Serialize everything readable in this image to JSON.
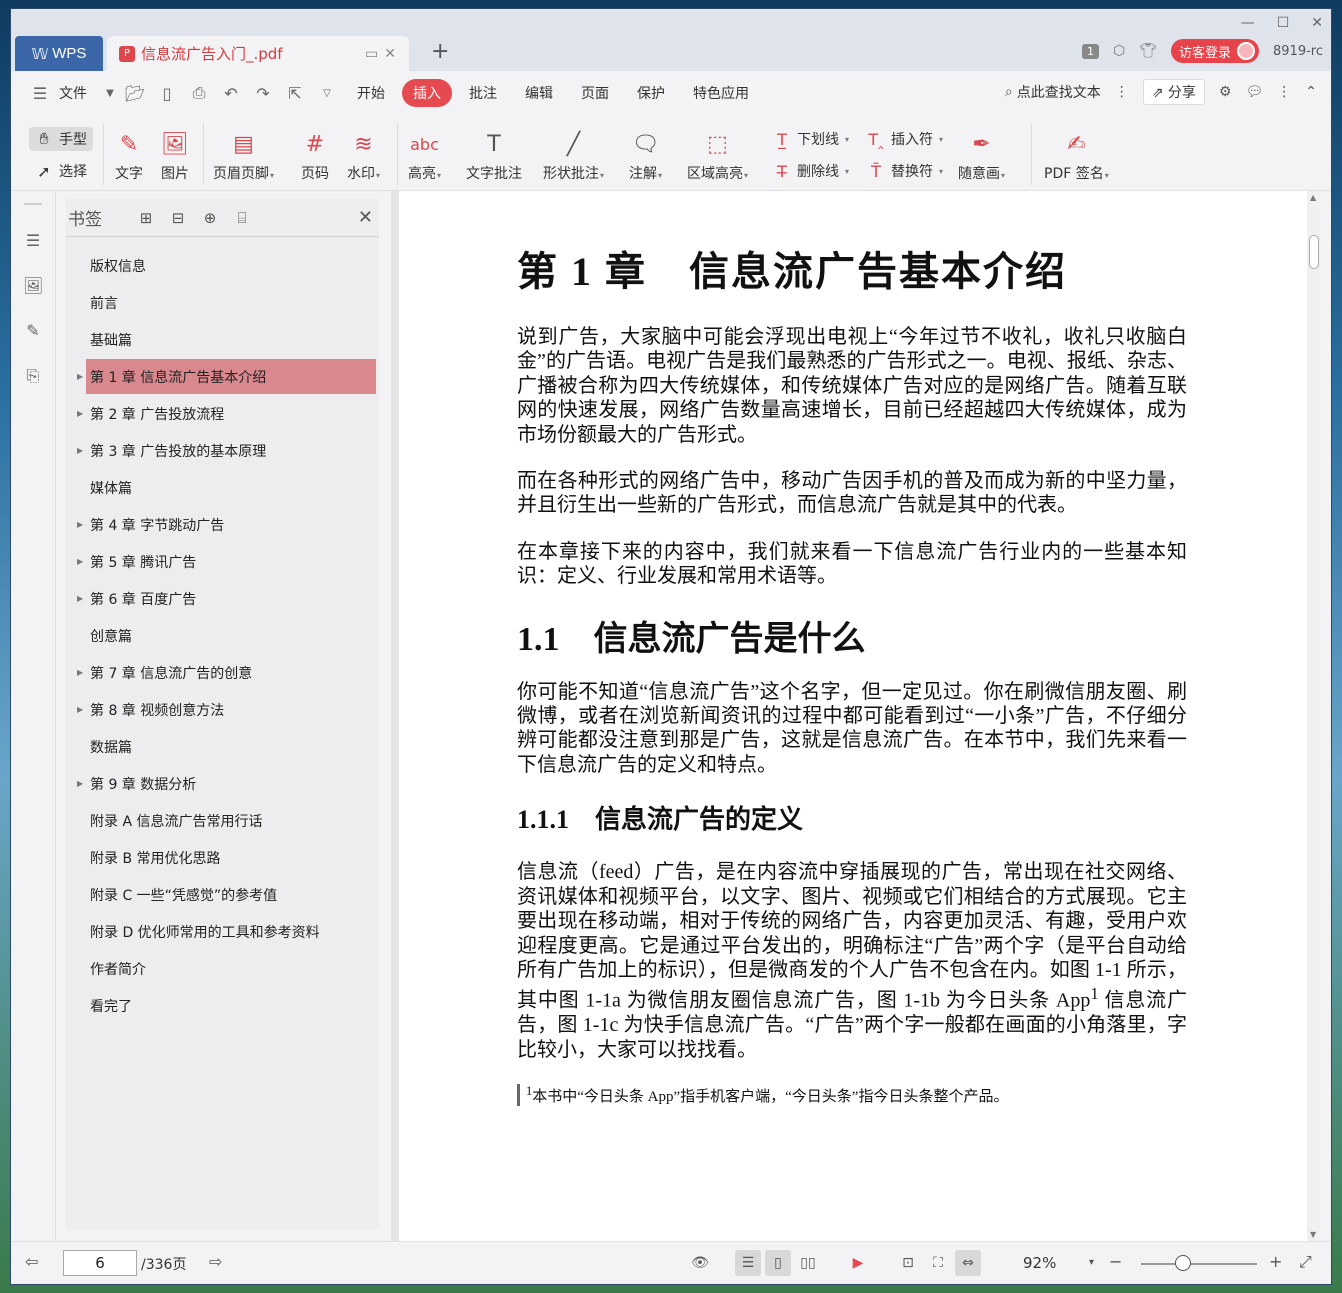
{
  "titlebar": {
    "app_tab": "WPS",
    "doc_tab": "信息流广告入门_.pdf",
    "page_badge": "1",
    "login": "访客登录",
    "user_id": "8919-rc"
  },
  "menubar": {
    "file": "文件",
    "items": [
      "开始",
      "插入",
      "批注",
      "编辑",
      "页面",
      "保护",
      "特色应用"
    ],
    "active": "插入",
    "search": "点此查找文本",
    "share": "分享"
  },
  "toolbar": {
    "hand": "手型",
    "select": "选择",
    "text": "文字",
    "image": "图片",
    "header_footer": "页眉页脚",
    "page_num": "页码",
    "watermark": "水印",
    "highlight": "高亮",
    "text_note": "文字批注",
    "shape_note": "形状批注",
    "annotation": "注解",
    "area_highlight": "区域高亮",
    "underline": "下划线",
    "strikethrough": "删除线",
    "insert_mark": "插入符",
    "replace_mark": "替换符",
    "freehand": "随意画",
    "pdf_sign": "PDF 签名"
  },
  "bookmarks": {
    "title": "书签",
    "items": [
      {
        "label": "版权信息",
        "expandable": false
      },
      {
        "label": "前言",
        "expandable": false
      },
      {
        "label": "基础篇",
        "expandable": false
      },
      {
        "label": "第 1 章 信息流广告基本介绍",
        "expandable": true,
        "selected": true
      },
      {
        "label": "第 2 章 广告投放流程",
        "expandable": true
      },
      {
        "label": "第 3 章 广告投放的基本原理",
        "expandable": true
      },
      {
        "label": "媒体篇",
        "expandable": false
      },
      {
        "label": "第 4 章 字节跳动广告",
        "expandable": true
      },
      {
        "label": "第 5 章 腾讯广告",
        "expandable": true
      },
      {
        "label": "第 6 章 百度广告",
        "expandable": true
      },
      {
        "label": "创意篇",
        "expandable": false
      },
      {
        "label": "第 7 章 信息流广告的创意",
        "expandable": true
      },
      {
        "label": "第 8 章 视频创意方法",
        "expandable": true
      },
      {
        "label": "数据篇",
        "expandable": false
      },
      {
        "label": "第 9 章 数据分析",
        "expandable": true
      },
      {
        "label": "附录 A 信息流广告常用行话",
        "expandable": false
      },
      {
        "label": "附录 B 常用优化思路",
        "expandable": false
      },
      {
        "label": "附录 C 一些“凭感觉”的参考值",
        "expandable": false
      },
      {
        "label": "附录 D 优化师常用的工具和参考资料",
        "expandable": false
      },
      {
        "label": "作者简介",
        "expandable": false
      },
      {
        "label": "看完了",
        "expandable": false
      }
    ]
  },
  "document": {
    "h1": "第 1 章　信息流广告基本介绍",
    "p1": "说到广告，大家脑中可能会浮现出电视上“今年过节不收礼，收礼只收脑白金”的广告语。电视广告是我们最熟悉的广告形式之一。电视、报纸、杂志、广播被合称为四大传统媒体，和传统媒体广告对应的是网络广告。随着互联网的快速发展，网络广告数量高速增长，目前已经超越四大传统媒体，成为市场份额最大的广告形式。",
    "p2": "而在各种形式的网络广告中，移动广告因手机的普及而成为新的中坚力量，并且衍生出一些新的广告形式，而信息流广告就是其中的代表。",
    "p3": "在本章接下来的内容中，我们就来看一下信息流广告行业内的一些基本知识：定义、行业发展和常用术语等。",
    "h2": "1.1　信息流广告是什么",
    "p4": "你可能不知道“信息流广告”这个名字，但一定见过。你在刷微信朋友圈、刷微博，或者在浏览新闻资讯的过程中都可能看到过“一小条”广告，不仔细分辨可能都没注意到那是广告，这就是信息流广告。在本节中，我们先来看一下信息流广告的定义和特点。",
    "h3": "1.1.1　信息流广告的定义",
    "p5a": "信息流（feed）广告，是在内容流中穿插展现的广告，常出现在社交网络、资讯媒体和视频平台，以文字、图片、视频或它们相结合的方式展现。它主要出现在移动端，相对于传统的网络广告，内容更加灵活、有趣，受用户欢迎程度更高。它是通过平台发出的，明确标注“广告”两个字（是平台自动给所有广告加上的标识），但是微商发的个人广告不包含在内。如图 1-1 所示，其中图 1-1a 为微信朋友圈信息流广告，图 1-1b 为今日头条 App",
    "sup": "1",
    "p5b": " 信息流广告，图 1-1c 为快手信息流广告。“广告”两个字一般都在画面的小角落里，字比较小，大家可以找找看。",
    "footnote_sup": "1",
    "footnote": "本书中“今日头条 App”指手机客户端，“今日头条”指今日头条整个产品。"
  },
  "statusbar": {
    "current_page": "6",
    "total": "/336页",
    "zoom": "92%",
    "zoom_level": 0.36
  },
  "colors": {
    "accent": "#e54a51",
    "selected_bookmark": "#d9888e",
    "wps_tab": "#3b67a8"
  }
}
